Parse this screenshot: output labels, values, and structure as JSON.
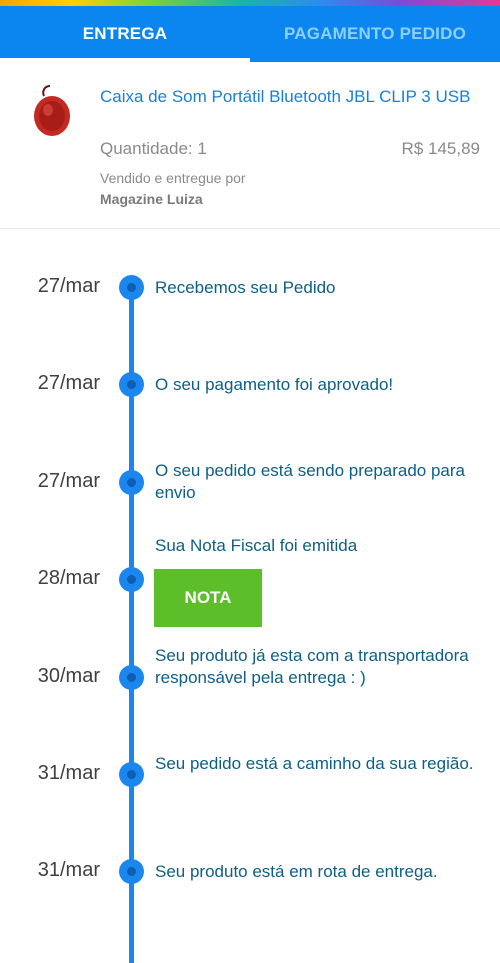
{
  "tabs": [
    {
      "label": "ENTREGA",
      "active": true
    },
    {
      "label": "PAGAMENTO PEDIDO",
      "active": false
    }
  ],
  "product": {
    "name": "Caixa de Som Portátil Bluetooth JBL CLIP 3 USB",
    "quantity": "Quantidade: 1",
    "price": "R$ 145,89",
    "sold_by": "Vendido e entregue por",
    "seller": "Magazine Luiza",
    "thumbnail_icon": "red-speaker-icon"
  },
  "timeline": [
    {
      "date": "27/mar",
      "text": "Recebemos seu Pedido"
    },
    {
      "date": "27/mar",
      "text": "O seu pagamento foi aprovado!"
    },
    {
      "date": "27/mar",
      "text": "O seu pedido está sendo preparado para envio"
    },
    {
      "date": "28/mar",
      "text": "Sua Nota Fiscal foi emitida",
      "button": "NOTA"
    },
    {
      "date": "30/mar",
      "text": "Seu produto já esta com a transportadora responsável pela entrega : )"
    },
    {
      "date": "31/mar",
      "text": "Seu pedido está a caminho da sua região."
    },
    {
      "date": "31/mar",
      "text": "Seu produto está em rota de entrega."
    }
  ],
  "colors": {
    "header": "#0b86f0",
    "accent": "#1a86ee",
    "link": "#1a7fd8",
    "event_text": "#0d5f86",
    "nota_button": "#5cbf2a"
  }
}
